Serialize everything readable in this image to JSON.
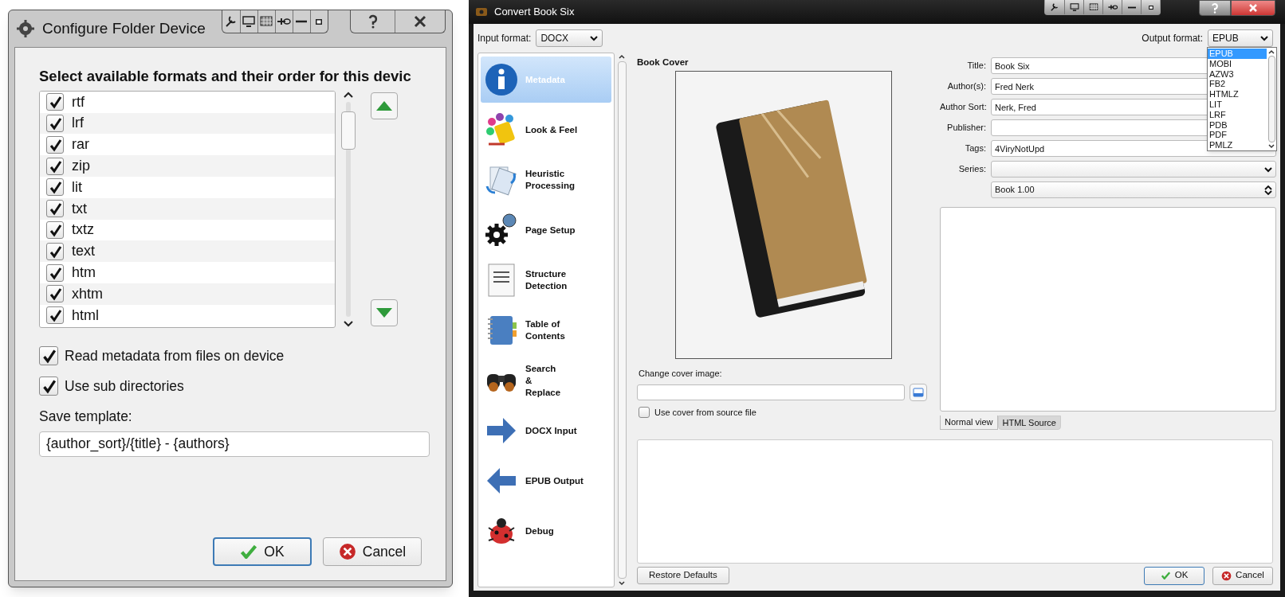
{
  "device_dialog": {
    "title": "Configure Folder Device",
    "heading": "Select available formats and their order for this devic",
    "formats": [
      {
        "label": "rtf",
        "checked": true
      },
      {
        "label": "lrf",
        "checked": true
      },
      {
        "label": "rar",
        "checked": true
      },
      {
        "label": "zip",
        "checked": true
      },
      {
        "label": "lit",
        "checked": true
      },
      {
        "label": "txt",
        "checked": true
      },
      {
        "label": "txtz",
        "checked": true
      },
      {
        "label": "text",
        "checked": true
      },
      {
        "label": "htm",
        "checked": true
      },
      {
        "label": "xhtm",
        "checked": true
      },
      {
        "label": "html",
        "checked": true
      }
    ],
    "options": [
      {
        "label": "Read metadata from files on device",
        "checked": true
      },
      {
        "label": "Use sub directories",
        "checked": true
      }
    ],
    "save_template": {
      "label": "Save template:",
      "value": "{author_sort}/{title} - {authors}"
    },
    "buttons": [
      {
        "label": "OK",
        "kind": "ok"
      },
      {
        "label": "Cancel",
        "kind": "cancel"
      }
    ]
  },
  "convert_window": {
    "title": "Convert Book Six",
    "input_format": {
      "label": "Input format:",
      "value": "DOCX"
    },
    "output_format": {
      "label": "Output format:",
      "value": "EPUB",
      "options": [
        {
          "label": "EPUB",
          "selected": true
        },
        {
          "label": "MOBI",
          "selected": false
        },
        {
          "label": "AZW3",
          "selected": false
        },
        {
          "label": "FB2",
          "selected": false
        },
        {
          "label": "HTMLZ",
          "selected": false
        },
        {
          "label": "LIT",
          "selected": false
        },
        {
          "label": "LRF",
          "selected": false
        },
        {
          "label": "PDB",
          "selected": false
        },
        {
          "label": "PDF",
          "selected": false
        },
        {
          "label": "PMLZ",
          "selected": false
        }
      ]
    },
    "sidebar": {
      "items": [
        {
          "label": "Metadata",
          "kind": "info",
          "selected": true
        },
        {
          "label": "Look & Feel",
          "kind": "paint",
          "selected": false
        },
        {
          "label": "Heuristic\nProcessing",
          "kind": "pages",
          "selected": false
        },
        {
          "label": "Page Setup",
          "kind": "gears",
          "selected": false
        },
        {
          "label": "Structure\nDetection",
          "kind": "document",
          "selected": false
        },
        {
          "label": "Table of\nContents",
          "kind": "notebook",
          "selected": false
        },
        {
          "label": "Search\n&\nReplace",
          "kind": "binoculars",
          "selected": false
        },
        {
          "label": "DOCX Input",
          "kind": "arrow-right",
          "selected": false
        },
        {
          "label": "EPUB Output",
          "kind": "arrow-left",
          "selected": false
        },
        {
          "label": "Debug",
          "kind": "bug",
          "selected": false
        }
      ]
    },
    "book_cover": {
      "heading": "Book Cover",
      "change_label": "Change cover image:",
      "use_source": {
        "label": "Use cover from source file",
        "checked": false
      }
    },
    "fields": [
      {
        "label": "Title:",
        "value": "Book Six",
        "kind": "text"
      },
      {
        "label": "Author(s):",
        "value": "Fred Nerk",
        "kind": "text"
      },
      {
        "label": "Author Sort:",
        "value": "Nerk, Fred",
        "kind": "text"
      },
      {
        "label": "Publisher:",
        "kind": "text"
      },
      {
        "label": "Tags:",
        "value": "4ViryNotUpd",
        "kind": "text"
      },
      {
        "label": "Series:",
        "kind": "combo"
      },
      {
        "value": "Book 1.00",
        "kind": "spin"
      }
    ],
    "view_tabs": [
      {
        "label": "Normal view",
        "selected": true
      },
      {
        "label": "HTML Source",
        "selected": false
      }
    ],
    "restore_button": "Restore Defaults",
    "buttons": [
      {
        "label": "OK",
        "kind": "ok"
      },
      {
        "label": "Cancel",
        "kind": "cancel"
      }
    ]
  }
}
